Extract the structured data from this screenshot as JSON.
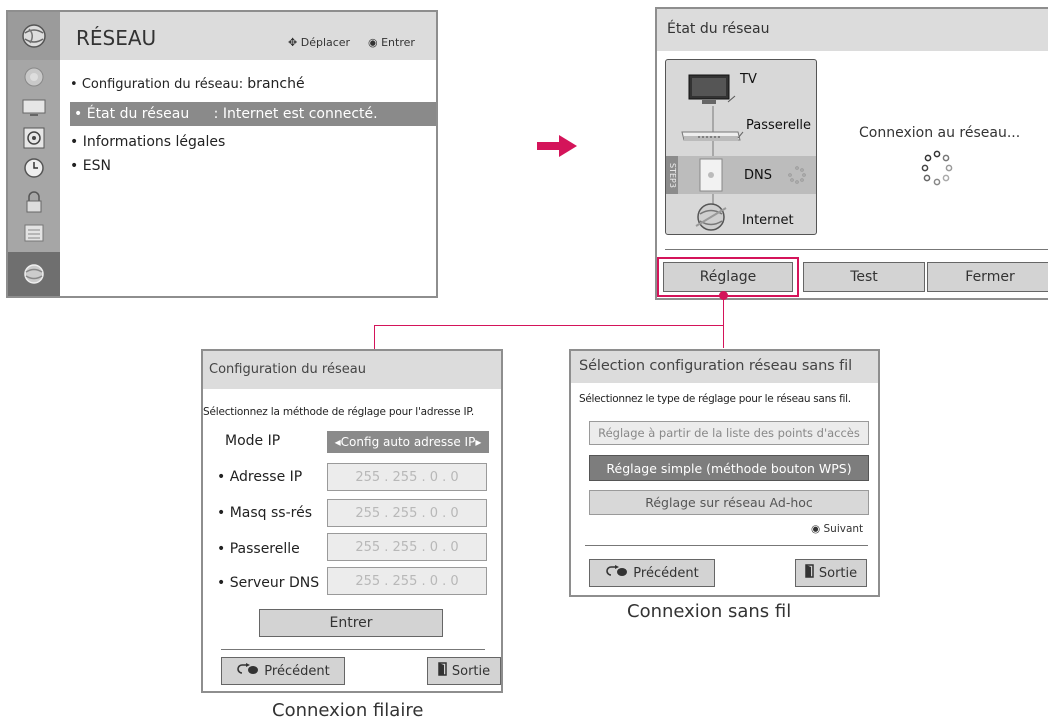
{
  "reseau_menu": {
    "title": "RÉSEAU",
    "hint_move": "Déplacer",
    "hint_enter": "Entrer",
    "items": [
      {
        "label": "Configuration du réseau",
        "value": "branché"
      },
      {
        "label": "État du réseau",
        "value": ": Internet est connecté."
      },
      {
        "label": "Informations légales"
      },
      {
        "label": "ESN"
      }
    ],
    "bullet": "•",
    "colon": ":"
  },
  "etat_reseau": {
    "title": "État du réseau",
    "tv": "TV",
    "passerelle": "Passerelle",
    "dns": "DNS",
    "step": "STEP3",
    "internet": "Internet",
    "status": "Connexion au réseau...",
    "buttons": {
      "reglage": "Réglage",
      "test": "Test",
      "fermer": "Fermer"
    }
  },
  "config_reseau": {
    "title": "Configuration du réseau",
    "instruction": "Sélectionnez la méthode de réglage pour l'adresse IP.",
    "mode_label": "Mode IP",
    "mode_value": "◂Config auto adresse IP▸",
    "fields": [
      {
        "label": "• Adresse IP",
        "value": "255 . 255 . 0 . 0"
      },
      {
        "label": "• Masq ss-rés",
        "value": "255 . 255 . 0 . 0"
      },
      {
        "label": "• Passerelle",
        "value": "255 . 255 . 0 . 0"
      },
      {
        "label": "• Serveur DNS",
        "value": "255 . 255 . 0 . 0"
      }
    ],
    "enter": "Entrer",
    "back": "Précédent",
    "exit": "Sortie"
  },
  "sans_fil": {
    "title": "Sélection configuration réseau sans fil",
    "instruction": "Sélectionnez le type de réglage pour le réseau sans fil.",
    "options": [
      "Réglage à partir de la liste des points d'accès",
      "Réglage simple (méthode bouton WPS)",
      "Réglage sur réseau Ad-hoc"
    ],
    "next": "Suivant",
    "back": "Précédent",
    "exit": "Sortie"
  },
  "captions": {
    "wireless": "Connexion sans fil",
    "wired": "Connexion filaire"
  },
  "colors": {
    "accent": "#d4145a",
    "highlight": "#8a8a8a",
    "sidebar": "#a6a6a6",
    "header": "#dcdcdc"
  }
}
